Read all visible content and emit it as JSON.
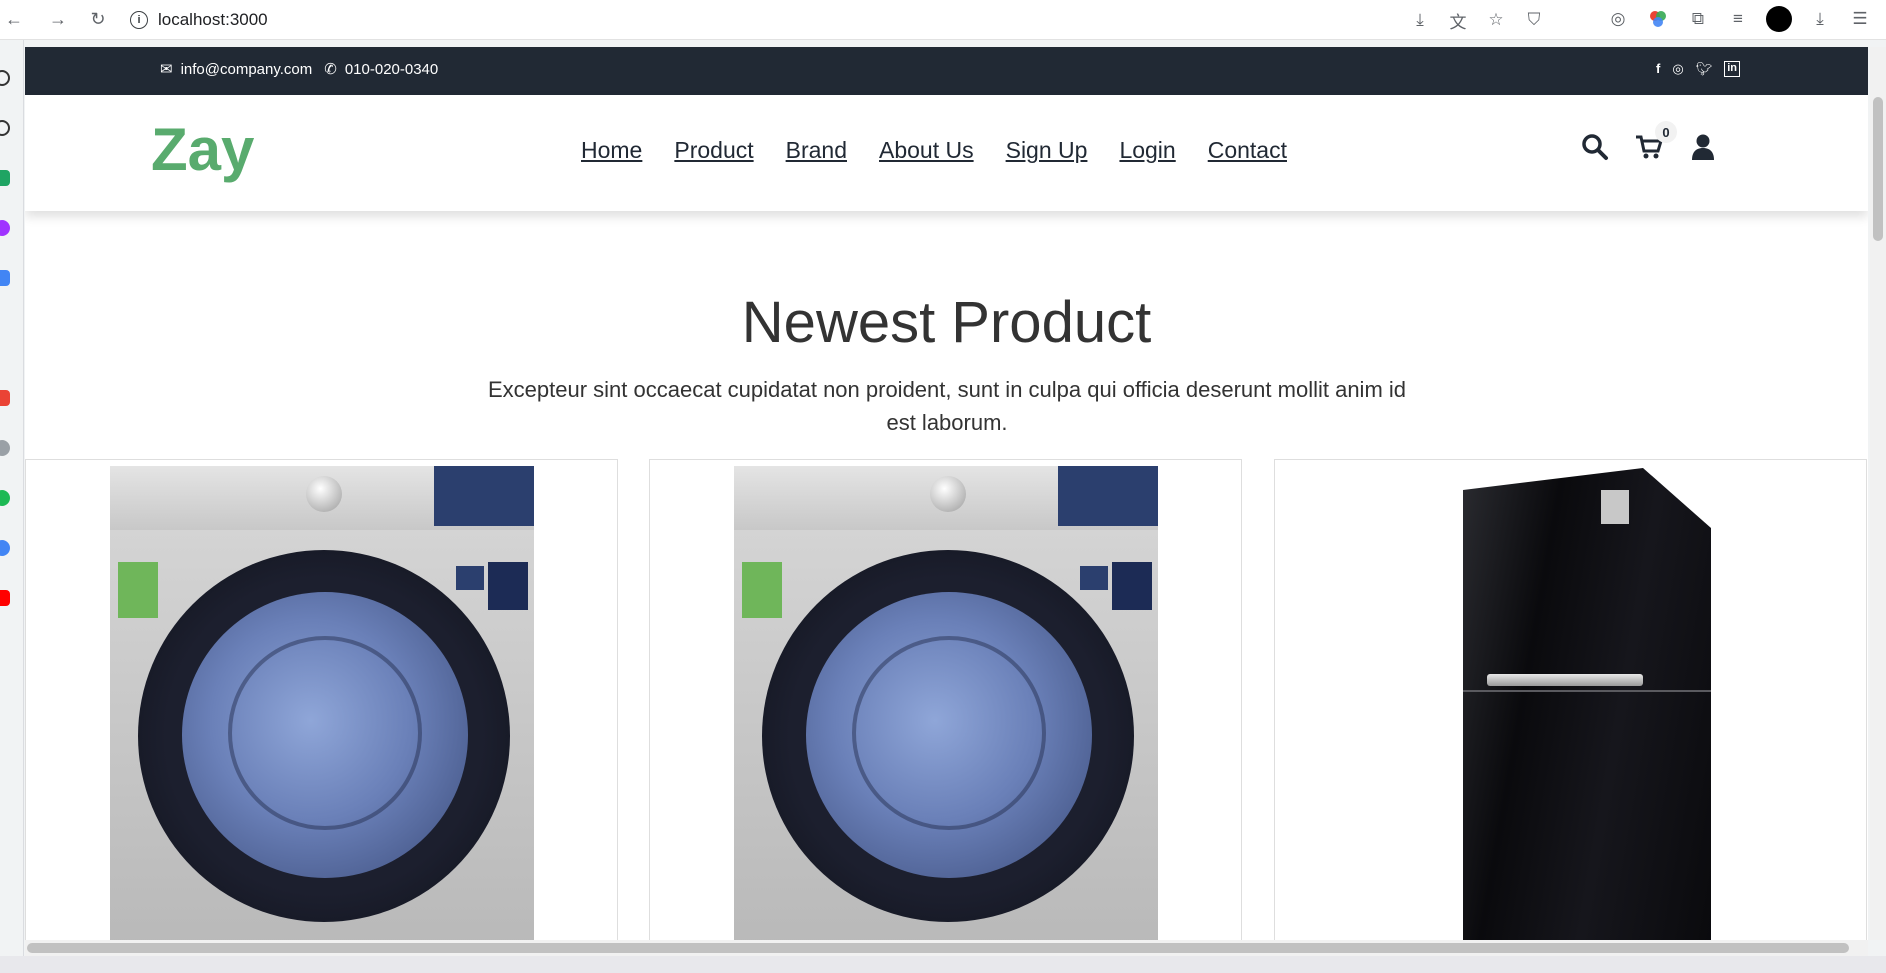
{
  "browser": {
    "url": "localhost:3000"
  },
  "topbar": {
    "email": "info@company.com",
    "phone": "010-020-0340",
    "social": [
      "facebook-icon",
      "instagram-icon",
      "twitter-icon",
      "linkedin-icon"
    ]
  },
  "header": {
    "logo": "Zay",
    "nav": [
      {
        "label": "Home"
      },
      {
        "label": "Product"
      },
      {
        "label": "Brand"
      },
      {
        "label": "About Us"
      },
      {
        "label": "Sign Up"
      },
      {
        "label": "Login"
      },
      {
        "label": "Contact"
      }
    ],
    "cart_count": "0"
  },
  "section": {
    "title": "Newest Product",
    "subtitle": "Excepteur sint occaecat cupidatat non proident, sunt in culpa qui officia deserunt mollit anim id est laborum."
  },
  "products": [
    {
      "image": "washing-machine"
    },
    {
      "image": "washing-machine"
    },
    {
      "image": "refrigerator"
    }
  ],
  "colors": {
    "topbar": "#212934",
    "logo": "#59ab6e"
  }
}
